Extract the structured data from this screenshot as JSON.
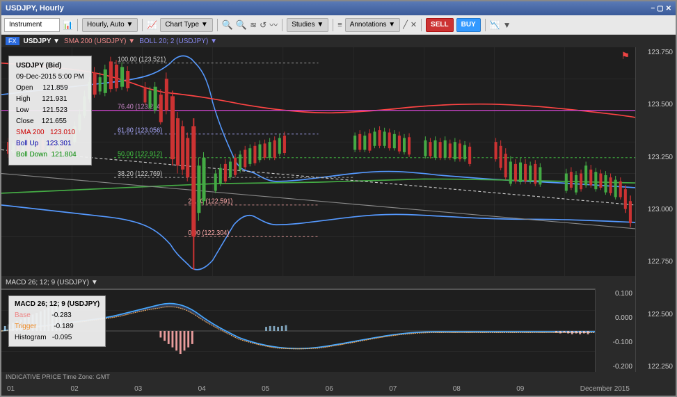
{
  "window": {
    "title": "USDJPY, Hourly",
    "controls": [
      "✕",
      "▢",
      "−"
    ]
  },
  "toolbar": {
    "instrument": "Instrument",
    "timeframe": "Hourly, Auto ▼",
    "chart_type_icon": "chart-icon",
    "chart_type_label": "Chart Type ▼",
    "zoom_in": "🔍+",
    "zoom_out": "🔍−",
    "compare": "≡",
    "refresh": "↺",
    "studies_label": "Studies ▼",
    "annotations_icon": "✏",
    "annotations_label": "Annotations ▼",
    "draw_line": "⟋",
    "delete": "✕",
    "sell_label": "SELL",
    "buy_label": "BUY",
    "chart_icons": "📈"
  },
  "chart_info": {
    "symbol": "FX",
    "pair": "USDJPY ▼",
    "sma": "SMA 200 (USDJPY) ▼",
    "boll": "BOLL 20; 2 (USDJPY) ▼"
  },
  "tooltip": {
    "pair": "USDJPY (Bid)",
    "date": "09-Dec-2015 5:00 PM",
    "open_label": "Open",
    "open_val": "121.859",
    "high_label": "High",
    "high_val": "121.931",
    "low_label": "Low",
    "low_val": "121.523",
    "close_label": "Close",
    "close_val": "121.655",
    "sma_label": "SMA 200",
    "sma_val": "123.010",
    "bollup_label": "Boll Up",
    "bollup_val": "123.301",
    "bolldown_label": "Boll Down",
    "bolldown_val": "121.804"
  },
  "macd_info": {
    "label": "MACD 26; 12; 9 (USDJPY) ▼"
  },
  "macd_tooltip": {
    "title": "MACD 26; 12; 9 (USDJPY)",
    "base_label": "Base",
    "base_val": "-0.283",
    "trigger_label": "Trigger",
    "trigger_val": "-0.189",
    "hist_label": "Histogram",
    "hist_val": "-0.095"
  },
  "price_axis": {
    "values": [
      "123.750",
      "123.500",
      "123.250",
      "123.000",
      "122.750",
      "122.500",
      "122.250"
    ]
  },
  "macd_axis": {
    "values": [
      "0.100",
      "0.000",
      "-0.100",
      "-0.200"
    ]
  },
  "fib_levels": [
    {
      "pct": "100.00",
      "val": "123.521"
    },
    {
      "pct": "76.40",
      "val": "123.234"
    },
    {
      "pct": "61.80",
      "val": "123.056"
    },
    {
      "pct": "50.00",
      "val": "122.912"
    },
    {
      "pct": "38.20",
      "val": "122.769"
    },
    {
      "pct": "23.60",
      "val": "122.591"
    },
    {
      "pct": "0.00",
      "val": "122.304"
    }
  ],
  "time_axis": {
    "labels": [
      "01",
      "02",
      "03",
      "04",
      "05",
      "06",
      "07",
      "08",
      "09"
    ],
    "month": "December 2015"
  },
  "indicative": "INDICATIVE PRICE  Time Zone: GMT"
}
